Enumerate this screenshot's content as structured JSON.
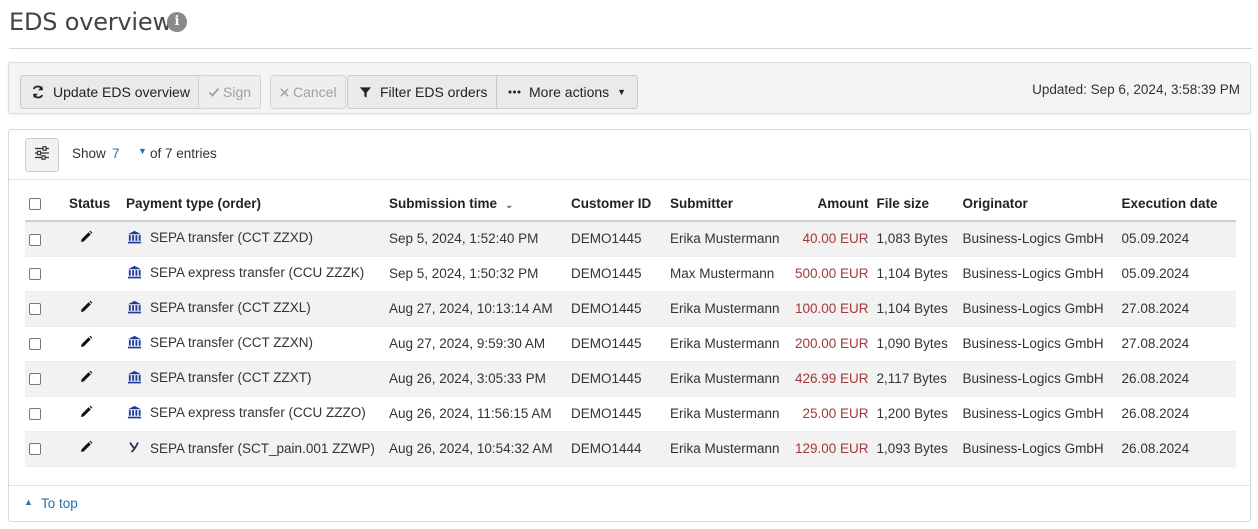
{
  "header": {
    "title": "EDS overview"
  },
  "toolbar": {
    "update_label": "Update EDS overview",
    "sign_label": "Sign",
    "cancel_label": "Cancel",
    "filter_label": "Filter EDS orders",
    "more_label": "More actions",
    "updated_text": "Updated: Sep 6, 2024, 3:58:39 PM"
  },
  "table_controls": {
    "show_label": "Show",
    "show_value": "7",
    "of_entries": "of 7 entries"
  },
  "columns": {
    "status": "Status",
    "payment_type": "Payment type (order)",
    "submission_time": "Submission time",
    "customer_id": "Customer ID",
    "submitter": "Submitter",
    "amount": "Amount",
    "file_size": "File size",
    "originator": "Originator",
    "execution_date": "Execution date"
  },
  "rows": [
    {
      "status_icon": "pencil-icon",
      "type_icon": "bank-icon",
      "payment_type": "SEPA transfer (CCT ZZXD)",
      "submission_time": "Sep 5, 2024, 1:52:40 PM",
      "customer_id": "DEMO1445",
      "submitter": "Erika Mustermann",
      "amount": "40.00 EUR",
      "file_size": "1,083 Bytes",
      "originator": "Business-Logics GmbH",
      "execution_date": "05.09.2024"
    },
    {
      "status_icon": "",
      "type_icon": "bank-icon",
      "payment_type": "SEPA express transfer (CCU ZZZK)",
      "submission_time": "Sep 5, 2024, 1:50:32 PM",
      "customer_id": "DEMO1445",
      "submitter": "Max Mustermann",
      "amount": "500.00 EUR",
      "file_size": "1,104 Bytes",
      "originator": "Business-Logics GmbH",
      "execution_date": "05.09.2024"
    },
    {
      "status_icon": "pencil-icon",
      "type_icon": "bank-icon",
      "payment_type": "SEPA transfer (CCT ZZXL)",
      "submission_time": "Aug 27, 2024, 10:13:14 AM",
      "customer_id": "DEMO1445",
      "submitter": "Erika Mustermann",
      "amount": "100.00 EUR",
      "file_size": "1,104 Bytes",
      "originator": "Business-Logics GmbH",
      "execution_date": "27.08.2024"
    },
    {
      "status_icon": "pencil-icon",
      "type_icon": "bank-icon",
      "payment_type": "SEPA transfer (CCT ZZXN)",
      "submission_time": "Aug 27, 2024, 9:59:30 AM",
      "customer_id": "DEMO1445",
      "submitter": "Erika Mustermann",
      "amount": "200.00 EUR",
      "file_size": "1,090 Bytes",
      "originator": "Business-Logics GmbH",
      "execution_date": "27.08.2024"
    },
    {
      "status_icon": "pencil-icon",
      "type_icon": "bank-icon",
      "payment_type": "SEPA transfer (CCT ZZXT)",
      "submission_time": "Aug 26, 2024, 3:05:33 PM",
      "customer_id": "DEMO1445",
      "submitter": "Erika Mustermann",
      "amount": "426.99 EUR",
      "file_size": "2,117 Bytes",
      "originator": "Business-Logics GmbH",
      "execution_date": "26.08.2024"
    },
    {
      "status_icon": "pencil-icon",
      "type_icon": "bank-icon",
      "payment_type": "SEPA express transfer (CCU ZZZO)",
      "submission_time": "Aug 26, 2024, 11:56:15 AM",
      "customer_id": "DEMO1445",
      "submitter": "Erika Mustermann",
      "amount": "25.00 EUR",
      "file_size": "1,200 Bytes",
      "originator": "Business-Logics GmbH",
      "execution_date": "26.08.2024"
    },
    {
      "status_icon": "pencil-icon",
      "type_icon": "y-icon",
      "payment_type": "SEPA transfer (SCT_pain.001 ZZWP)",
      "submission_time": "Aug 26, 2024, 10:54:32 AM",
      "customer_id": "DEMO1444",
      "submitter": "Erika Mustermann",
      "amount": "129.00 EUR",
      "file_size": "1,093 Bytes",
      "originator": "Business-Logics GmbH",
      "execution_date": "26.08.2024"
    }
  ],
  "footer": {
    "to_top": "To top"
  },
  "colors": {
    "link": "#2a6db3",
    "amount": "#a23a3a",
    "bank_icon": "#1e3a9a"
  }
}
